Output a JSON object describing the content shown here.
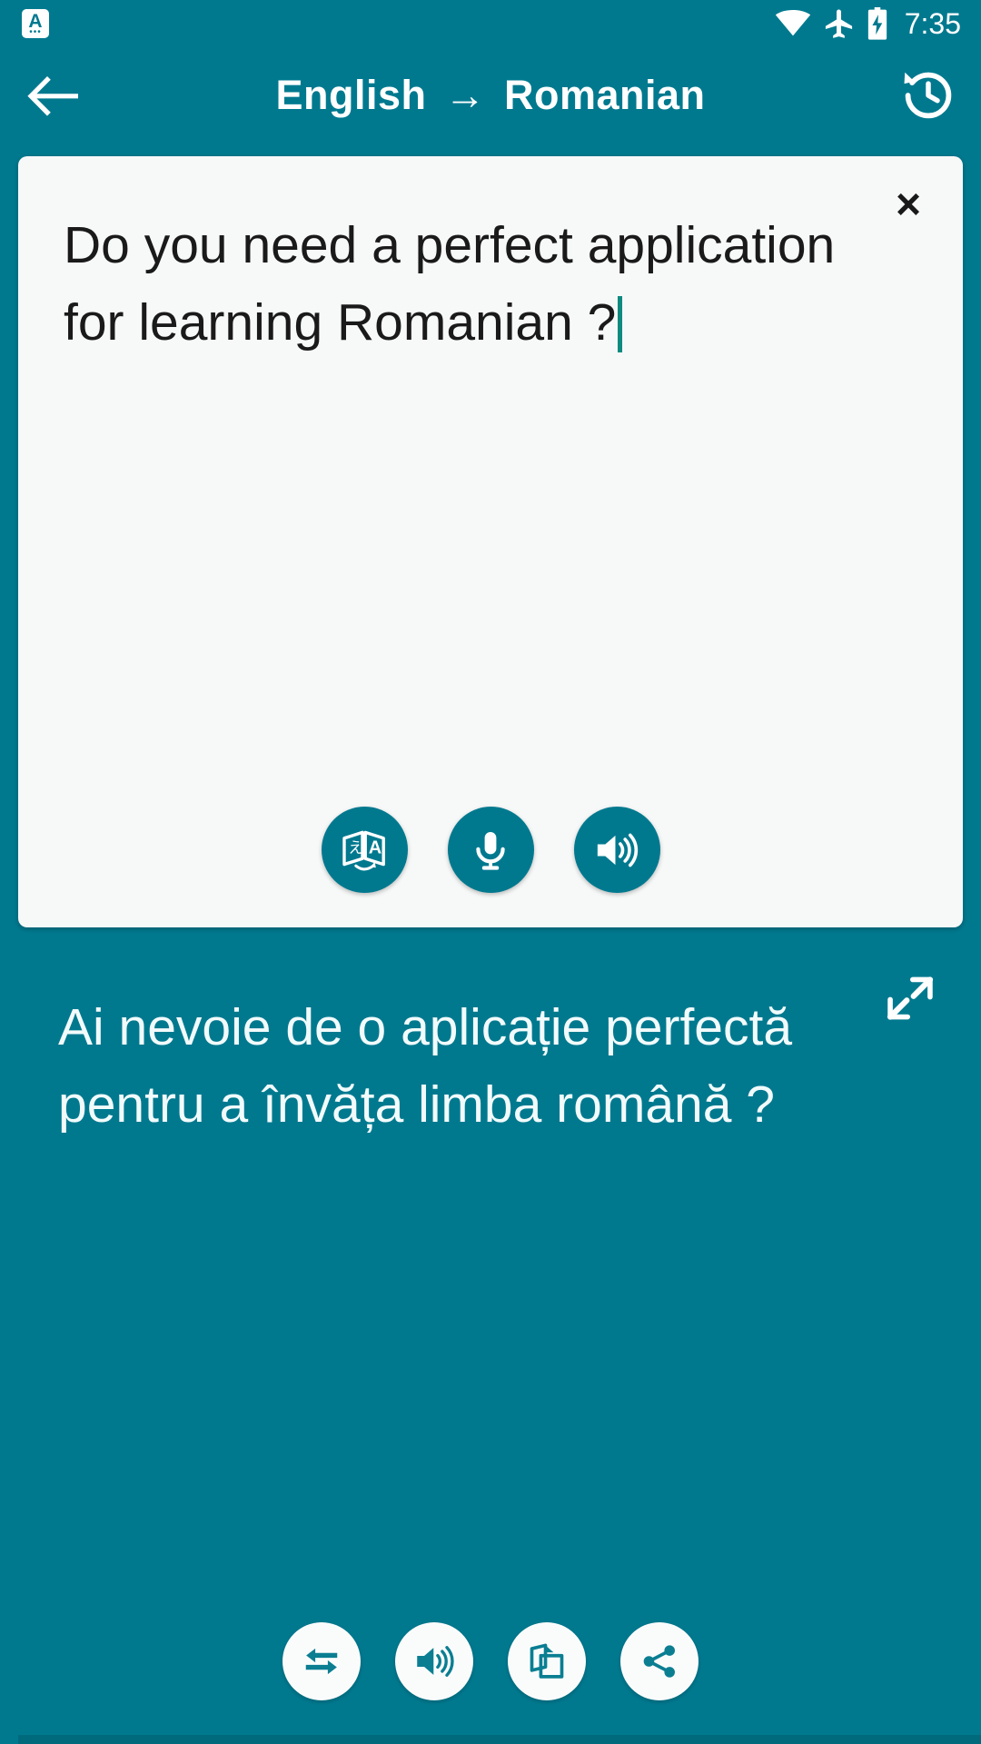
{
  "status_bar": {
    "notification_letter": "A",
    "notification_dots": "•••",
    "icons": [
      "wifi-icon",
      "airplane-mode-icon",
      "battery-charging-icon"
    ],
    "time": "7:35"
  },
  "app_bar": {
    "back_icon": "back-arrow-icon",
    "source_language": "English",
    "arrow": "→",
    "target_language": "Romanian",
    "history_icon": "history-icon"
  },
  "source_card": {
    "close_label": "×",
    "text": "Do you need a perfect application for learning Romanian ?",
    "caret_visible": true,
    "actions": [
      {
        "name": "translate-button",
        "icon": "translate-icon"
      },
      {
        "name": "microphone-button",
        "icon": "microphone-icon"
      },
      {
        "name": "speak-source-button",
        "icon": "speaker-icon"
      }
    ]
  },
  "target_card": {
    "expand_icon": "expand-fullscreen-icon",
    "text": "Ai nevoie de o aplicație perfectă pentru a învăța limba română ?",
    "actions": [
      {
        "name": "swap-languages-button",
        "icon": "swap-arrows-icon"
      },
      {
        "name": "speak-translation-button",
        "icon": "speaker-icon"
      },
      {
        "name": "copy-button",
        "icon": "copy-icon"
      },
      {
        "name": "share-button",
        "icon": "share-icon"
      }
    ]
  },
  "colors": {
    "primary": "#00798f",
    "card_light": "#f7f8f8",
    "caret": "#0f8a81",
    "text_dark": "#1a1a1a",
    "text_light": "#f2fbfb"
  }
}
